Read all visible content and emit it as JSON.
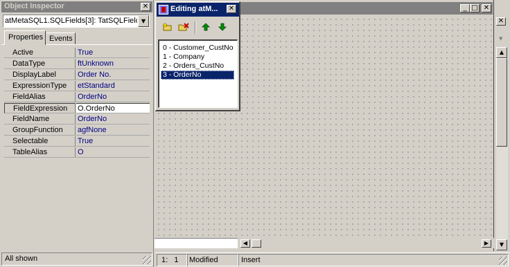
{
  "object_inspector": {
    "title": "Object Inspector",
    "selector_value": "atMetaSQL1.SQLFields[3]: TatSQLField",
    "tabs": [
      {
        "label": "Properties"
      },
      {
        "label": "Events"
      }
    ],
    "properties": [
      {
        "name": "Active",
        "value": "True"
      },
      {
        "name": "DataType",
        "value": "ftUnknown"
      },
      {
        "name": "DisplayLabel",
        "value": "Order No."
      },
      {
        "name": "ExpressionType",
        "value": "etStandard"
      },
      {
        "name": "FieldAlias",
        "value": "OrderNo"
      },
      {
        "name": "FieldExpression",
        "value": "O.OrderNo"
      },
      {
        "name": "FieldName",
        "value": "OrderNo"
      },
      {
        "name": "GroupFunction",
        "value": "agfNone"
      },
      {
        "name": "Selectable",
        "value": "True"
      },
      {
        "name": "TableAlias",
        "value": "O"
      }
    ],
    "status": "All shown"
  },
  "editor_dialog": {
    "title": "Editing atM...",
    "items": [
      "0 - Customer_CustNo",
      "1 - Company",
      "2 - Orders_CustNo",
      "3 - OrderNo"
    ],
    "selected_index": 3
  },
  "statusbar": {
    "position": "1:   1",
    "state": "Modified",
    "mode": "Insert"
  },
  "icons": {
    "add": "add-item-icon",
    "delete": "delete-item-icon",
    "up": "move-up-icon",
    "down": "move-down-icon"
  }
}
